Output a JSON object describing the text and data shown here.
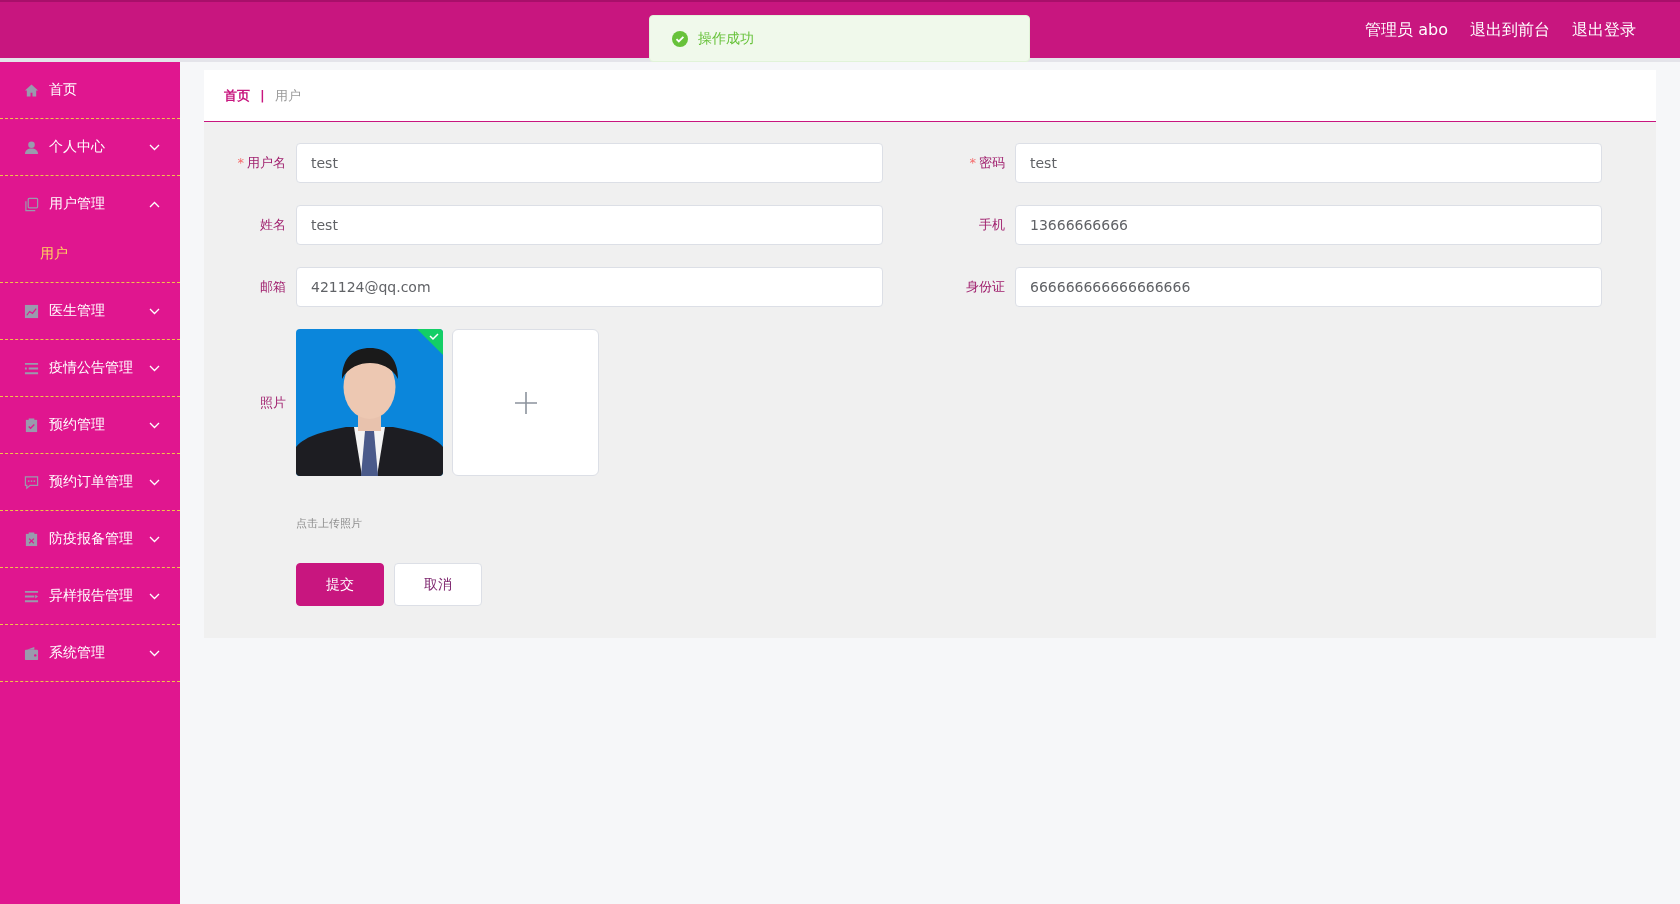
{
  "header": {
    "user_label": "管理员 abo",
    "links": [
      "退出到前台",
      "退出登录"
    ]
  },
  "toast": {
    "kind": "success",
    "message": "操作成功"
  },
  "sidebar": {
    "items": [
      {
        "label": "首页",
        "kind": "link"
      },
      {
        "label": "个人中心",
        "kind": "group",
        "expanded": false
      },
      {
        "label": "用户管理",
        "kind": "group",
        "expanded": true,
        "children": [
          {
            "label": "用户",
            "selected": true
          }
        ]
      },
      {
        "label": "医生管理",
        "kind": "group",
        "expanded": false
      },
      {
        "label": "疫情公告管理",
        "kind": "group",
        "expanded": false
      },
      {
        "label": "预约管理",
        "kind": "group",
        "expanded": false
      },
      {
        "label": "预约订单管理",
        "kind": "group",
        "expanded": false
      },
      {
        "label": "防疫报备管理",
        "kind": "group",
        "expanded": false
      },
      {
        "label": "异样报告管理",
        "kind": "group",
        "expanded": false
      },
      {
        "label": "系统管理",
        "kind": "group",
        "expanded": false
      }
    ]
  },
  "breadcrumb_separator": "|",
  "breadcrumb": [
    {
      "label": "首页",
      "current": false
    },
    {
      "label": "用户",
      "current": true
    }
  ],
  "form": {
    "required_mark": "*",
    "fields": [
      {
        "label": "用户名",
        "value": "test",
        "required": true
      },
      {
        "label": "密码",
        "value": "test",
        "required": true
      },
      {
        "label": "姓名",
        "value": "test",
        "required": false
      },
      {
        "label": "手机",
        "value": "13666666666",
        "required": false
      },
      {
        "label": "邮箱",
        "value": "421124@qq.com",
        "required": false
      },
      {
        "label": "身份证",
        "value": "666666666666666666",
        "required": false
      }
    ],
    "photo": {
      "label": "照片",
      "hint": "点击上传照片",
      "uploaded": true,
      "kind": "picture"
    },
    "buttons": [
      {
        "label": "提交",
        "kind": "primary"
      },
      {
        "label": "取消",
        "kind": "default"
      }
    ]
  }
}
